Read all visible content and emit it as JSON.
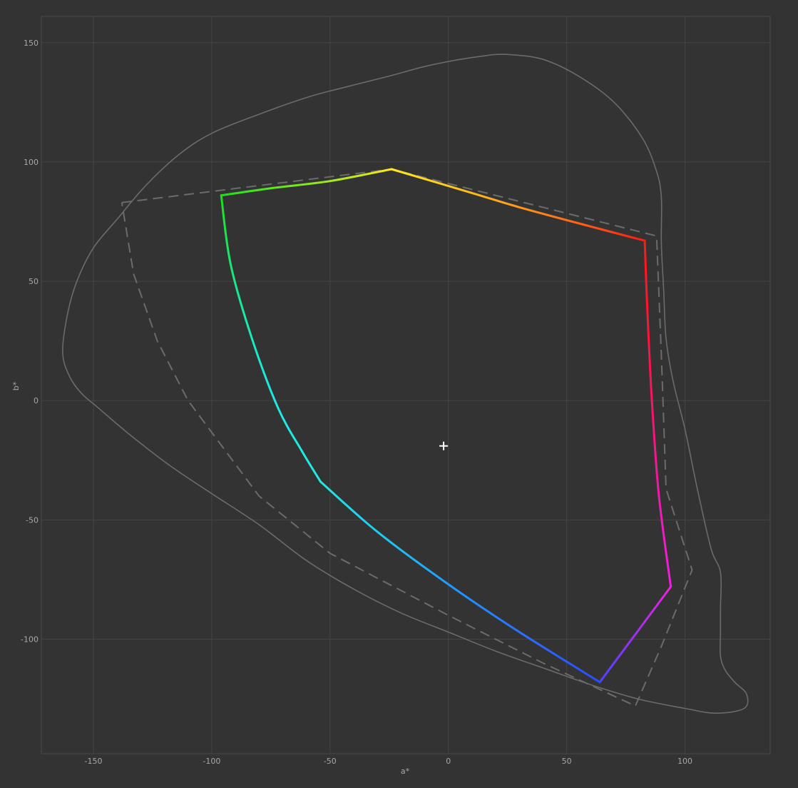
{
  "chart_data": {
    "type": "line",
    "xlabel": "a*",
    "ylabel": "b*",
    "xlim": [
      -172,
      136
    ],
    "ylim": [
      -148,
      161
    ],
    "xticks": [
      -150,
      -100,
      -50,
      0,
      50,
      100
    ],
    "yticks": [
      150,
      100,
      50,
      0,
      -50,
      -100
    ],
    "grid": true,
    "colors": {
      "background": "#333333",
      "grid": "#444444",
      "plot_border": "#4a4a4a",
      "reference_lines": "#6b6b6b",
      "white_point": "#ffffff"
    },
    "white_point": {
      "a": -2,
      "b": -19
    },
    "series": [
      {
        "style": "solid-reference",
        "points": [
          [
            19,
            145
          ],
          [
            5,
            143
          ],
          [
            -10,
            140
          ],
          [
            -25,
            136
          ],
          [
            -45,
            131
          ],
          [
            -60,
            127
          ],
          [
            -80,
            120
          ],
          [
            -100,
            112
          ],
          [
            -114,
            103
          ],
          [
            -128,
            90
          ],
          [
            -140,
            76
          ],
          [
            -150,
            64
          ],
          [
            -157,
            50
          ],
          [
            -161,
            36
          ],
          [
            -163,
            20
          ],
          [
            -160,
            10
          ],
          [
            -155,
            3
          ],
          [
            -148,
            -3
          ],
          [
            -135,
            -14
          ],
          [
            -118,
            -27
          ],
          [
            -100,
            -39
          ],
          [
            -80,
            -52
          ],
          [
            -60,
            -67
          ],
          [
            -40,
            -79
          ],
          [
            -20,
            -89
          ],
          [
            0,
            -97
          ],
          [
            20,
            -105
          ],
          [
            40,
            -112
          ],
          [
            60,
            -119
          ],
          [
            80,
            -125
          ],
          [
            100,
            -129
          ],
          [
            113,
            -131
          ],
          [
            125,
            -129
          ],
          [
            126,
            -123
          ],
          [
            121,
            -118
          ],
          [
            117,
            -113
          ],
          [
            115,
            -107
          ],
          [
            115,
            -97
          ],
          [
            115,
            -87
          ],
          [
            115,
            -72
          ],
          [
            111,
            -62
          ],
          [
            105,
            -36
          ],
          [
            100,
            -12
          ],
          [
            95,
            8
          ],
          [
            92,
            26
          ],
          [
            91,
            46
          ],
          [
            90,
            66
          ],
          [
            90,
            85
          ],
          [
            88,
            96
          ],
          [
            82,
            110
          ],
          [
            70,
            125
          ],
          [
            55,
            136
          ],
          [
            40,
            143
          ],
          [
            26,
            145
          ],
          [
            19,
            145
          ]
        ]
      },
      {
        "style": "dashed-reference",
        "points": [
          [
            -138,
            83
          ],
          [
            -24,
            97
          ],
          [
            88,
            69
          ],
          [
            90,
            19
          ],
          [
            92,
            -37
          ],
          [
            103,
            -71
          ],
          [
            90,
            -103
          ],
          [
            79,
            -128
          ],
          [
            40,
            -110
          ],
          [
            0,
            -90
          ],
          [
            -50,
            -64
          ],
          [
            -80,
            -40
          ],
          [
            -95,
            -20
          ],
          [
            -110,
            0
          ],
          [
            -123,
            25
          ],
          [
            -133,
            53
          ],
          [
            -138,
            83
          ]
        ]
      },
      {
        "style": "gradient-gamut",
        "vertices": [
          {
            "name": "red",
            "a": 83,
            "b": 67,
            "color": "#ff1a14"
          },
          {
            "name": "yellow",
            "a": -24,
            "b": 97,
            "color": "#ffe81e"
          },
          {
            "name": "green",
            "a": -96,
            "b": 86,
            "color": "#1ee01a"
          },
          {
            "name": "cyan",
            "a": -54,
            "b": -34,
            "color": "#20e8e4"
          },
          {
            "name": "blue",
            "a": 64,
            "b": -118,
            "color": "#2a4cff"
          },
          {
            "name": "magenta",
            "a": 94,
            "b": -78,
            "color": "#f020e0"
          }
        ],
        "edges": [
          {
            "from": "red",
            "to": "yellow",
            "points": [
              [
                83,
                67
              ],
              [
                60,
                73
              ],
              [
                30,
                81
              ],
              [
                10,
                87
              ],
              [
                -24,
                97
              ]
            ],
            "stops": [
              "#ff1a14",
              "#ff6014",
              "#ff9a1a",
              "#ffc41e",
              "#ffe81e"
            ]
          },
          {
            "from": "yellow",
            "to": "green",
            "points": [
              [
                -24,
                97
              ],
              [
                -50,
                92
              ],
              [
                -75,
                89
              ],
              [
                -96,
                86
              ]
            ],
            "stops": [
              "#ffe81e",
              "#a8e81e",
              "#60e81c",
              "#1ee01a"
            ]
          },
          {
            "from": "green",
            "to": "cyan",
            "points": [
              [
                -96,
                86
              ],
              [
                -92,
                57
              ],
              [
                -83,
                26
              ],
              [
                -72,
                -3
              ],
              [
                -62,
                -21
              ],
              [
                -54,
                -34
              ]
            ],
            "stops": [
              "#1ee01a",
              "#18e86a",
              "#18eaa8",
              "#1ee8d6",
              "#20e8e4",
              "#20e8e4"
            ]
          },
          {
            "from": "cyan",
            "to": "blue",
            "points": [
              [
                -54,
                -34
              ],
              [
                -30,
                -55
              ],
              [
                0,
                -77
              ],
              [
                30,
                -97
              ],
              [
                64,
                -118
              ]
            ],
            "stops": [
              "#20e8e4",
              "#1ec8f2",
              "#1e98ff",
              "#2a6eff",
              "#2a4cff"
            ]
          },
          {
            "from": "blue",
            "to": "magenta",
            "points": [
              [
                64,
                -118
              ],
              [
                94,
                -78
              ]
            ],
            "stops": [
              "#5040ff",
              "#f020e0"
            ]
          },
          {
            "from": "magenta",
            "to": "red",
            "points": [
              [
                94,
                -78
              ],
              [
                89,
                -40
              ],
              [
                86,
                0
              ],
              [
                84,
                40
              ],
              [
                83,
                67
              ]
            ],
            "stops": [
              "#f020e0",
              "#f01ab0",
              "#f8146e",
              "#ff1436",
              "#ff1a14"
            ]
          }
        ]
      }
    ]
  }
}
